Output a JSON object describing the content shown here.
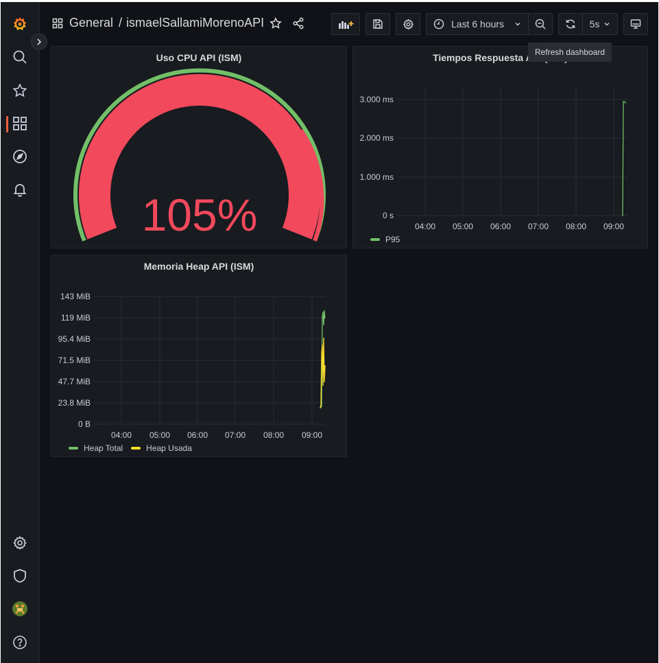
{
  "breadcrumb": {
    "folder": "General",
    "separator": "/",
    "dashboard": "ismaelSallamiMorenoAPI"
  },
  "toolbar": {
    "time_range": "Last 6 hours",
    "refresh_interval": "5s",
    "tooltip": "Refresh dashboard"
  },
  "colors": {
    "green": "#73bf69",
    "red": "#f2495c",
    "yellow": "#fade2a",
    "accent": "#f55f3e"
  },
  "panels": {
    "cpu": {
      "title": "Uso CPU API (ISM)",
      "value": "105%",
      "value_number": 105
    },
    "response": {
      "title": "Tiempos Respuesta API (ISM)",
      "y_ticks": [
        "3.000 ms",
        "2.000 ms",
        "1.000 ms",
        "0 s"
      ],
      "x_ticks": [
        "04:00",
        "05:00",
        "06:00",
        "07:00",
        "08:00",
        "09:00"
      ],
      "legend": [
        "P95"
      ]
    },
    "heap": {
      "title": "Memoria Heap API (ISM)",
      "y_ticks": [
        "143 MiB",
        "119 MiB",
        "95.4 MiB",
        "71.5 MiB",
        "47.7 MiB",
        "23.8 MiB",
        "0 B"
      ],
      "x_ticks": [
        "04:00",
        "05:00",
        "06:00",
        "07:00",
        "08:00",
        "09:00"
      ],
      "legend": [
        "Heap Total",
        "Heap Usada"
      ]
    }
  },
  "icons": {
    "sidebar_top": [
      "grafana-logo-icon",
      "search-icon",
      "star-icon",
      "dashboards-icon",
      "explore-icon",
      "alerting-icon"
    ],
    "sidebar_bottom": [
      "configuration-icon",
      "shield-icon",
      "avatar",
      "help-icon"
    ]
  }
}
